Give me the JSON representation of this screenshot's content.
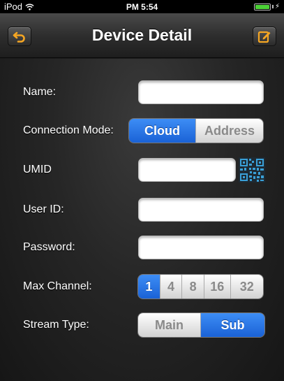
{
  "status_bar": {
    "device": "iPod",
    "time": "PM 5:54",
    "charging_glyph": "⚡"
  },
  "nav": {
    "title": "Device Detail",
    "back_icon": "back-arrow-icon",
    "edit_icon": "edit-icon"
  },
  "form": {
    "name_label": "Name:",
    "name_value": "",
    "connection_label": "Connection Mode:",
    "connection_options": [
      "Cloud",
      "Address"
    ],
    "connection_selected": "Cloud",
    "umid_label": "UMID",
    "umid_value": "",
    "userid_label": "User ID:",
    "userid_value": "",
    "password_label": "Password:",
    "password_value": "",
    "max_channel_label": "Max Channel:",
    "max_channel_options": [
      "1",
      "4",
      "8",
      "16",
      "32"
    ],
    "max_channel_selected": "1",
    "stream_label": "Stream Type:",
    "stream_options": [
      "Main",
      "Sub"
    ],
    "stream_selected": "Sub"
  },
  "colors": {
    "accent_blue": "#1a62d6",
    "nav_icon_orange": "#f5a623",
    "battery_green": "#4cd137",
    "qr_blue": "#3aa0d8"
  }
}
